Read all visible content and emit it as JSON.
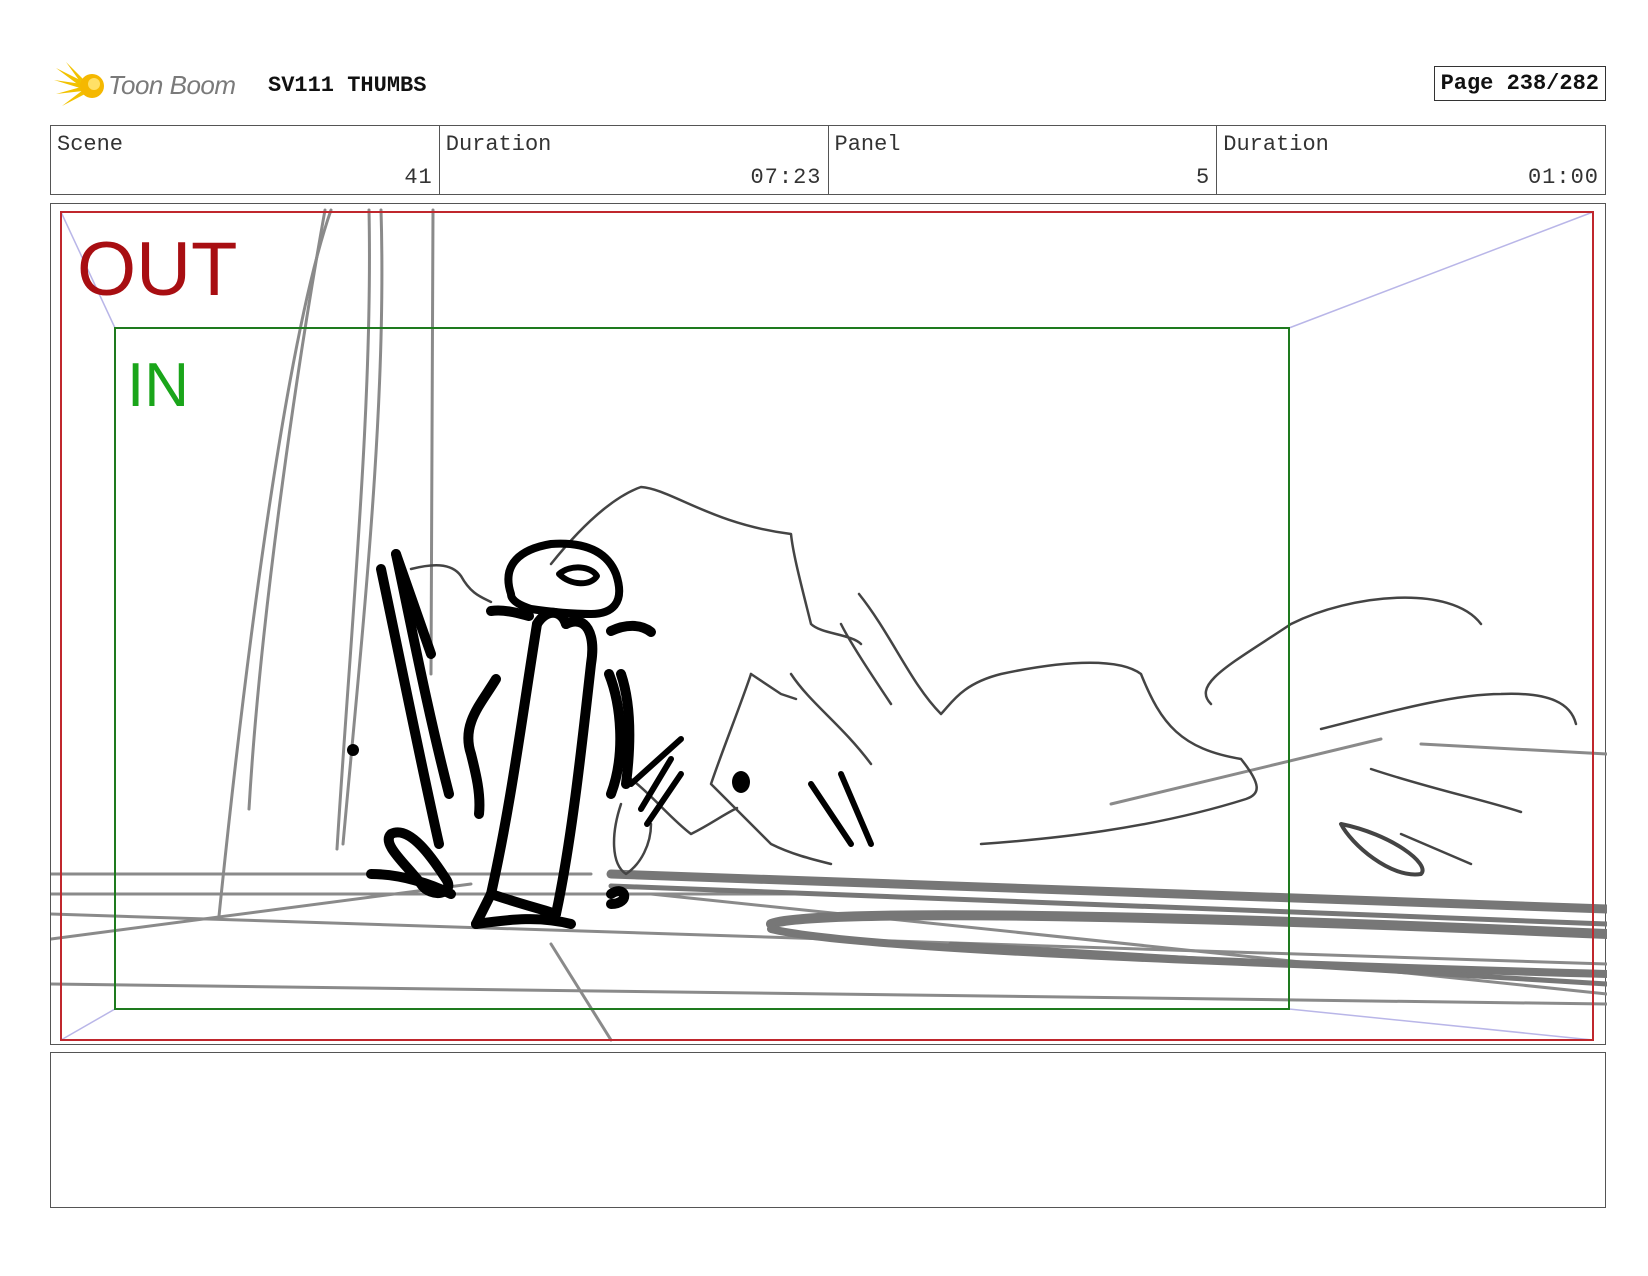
{
  "header": {
    "brand": "Toon Boom",
    "project": "SV111 THUMBS",
    "page": "Page 238/282"
  },
  "info": [
    {
      "label": "Scene",
      "value": "41"
    },
    {
      "label": "Duration",
      "value": "07:23"
    },
    {
      "label": "Panel",
      "value": "5"
    },
    {
      "label": "Duration",
      "value": "01:00"
    }
  ],
  "panel": {
    "out_label": "OUT",
    "in_label": "IN",
    "colors": {
      "out_frame": "#c0272d",
      "in_frame": "#1e7a1e",
      "guides": "#b9b6e8"
    }
  },
  "notes": {
    "text": ""
  }
}
